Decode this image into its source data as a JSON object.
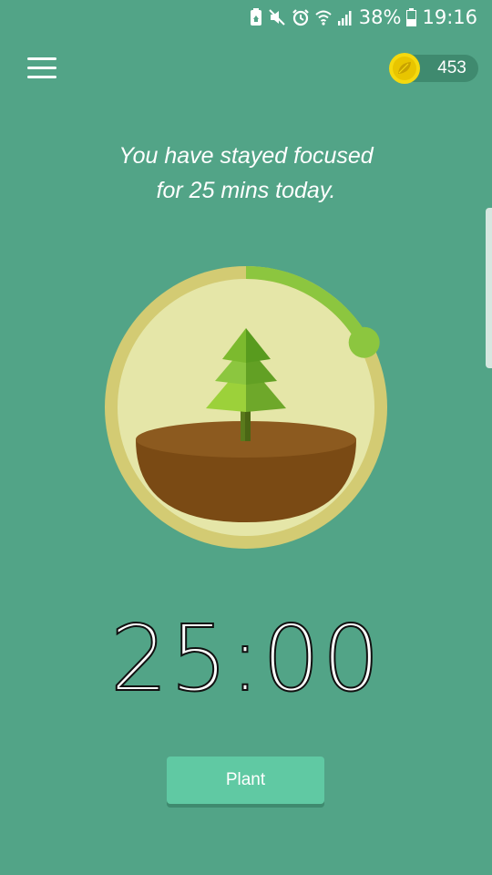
{
  "status_bar": {
    "battery_percent": "38%",
    "time": "19:16",
    "icons": [
      "battery-saver-icon",
      "mute-icon",
      "alarm-icon",
      "wifi-icon",
      "signal-icon",
      "battery-icon"
    ]
  },
  "header": {
    "menu_icon": "hamburger-menu-icon",
    "coin_icon": "leaf-coin-icon",
    "coins": "453"
  },
  "message": {
    "line1": "You have stayed focused",
    "line2": "for 25 mins today."
  },
  "progress": {
    "fraction": 0.17
  },
  "timer": {
    "value": "25:00"
  },
  "actions": {
    "plant_label": "Plant"
  },
  "colors": {
    "background": "#52a487",
    "ring": "#d3cb73",
    "progress": "#8cc63f",
    "soil": "#7a4a14",
    "tree": "#79b82c",
    "button": "#60c9a3"
  }
}
